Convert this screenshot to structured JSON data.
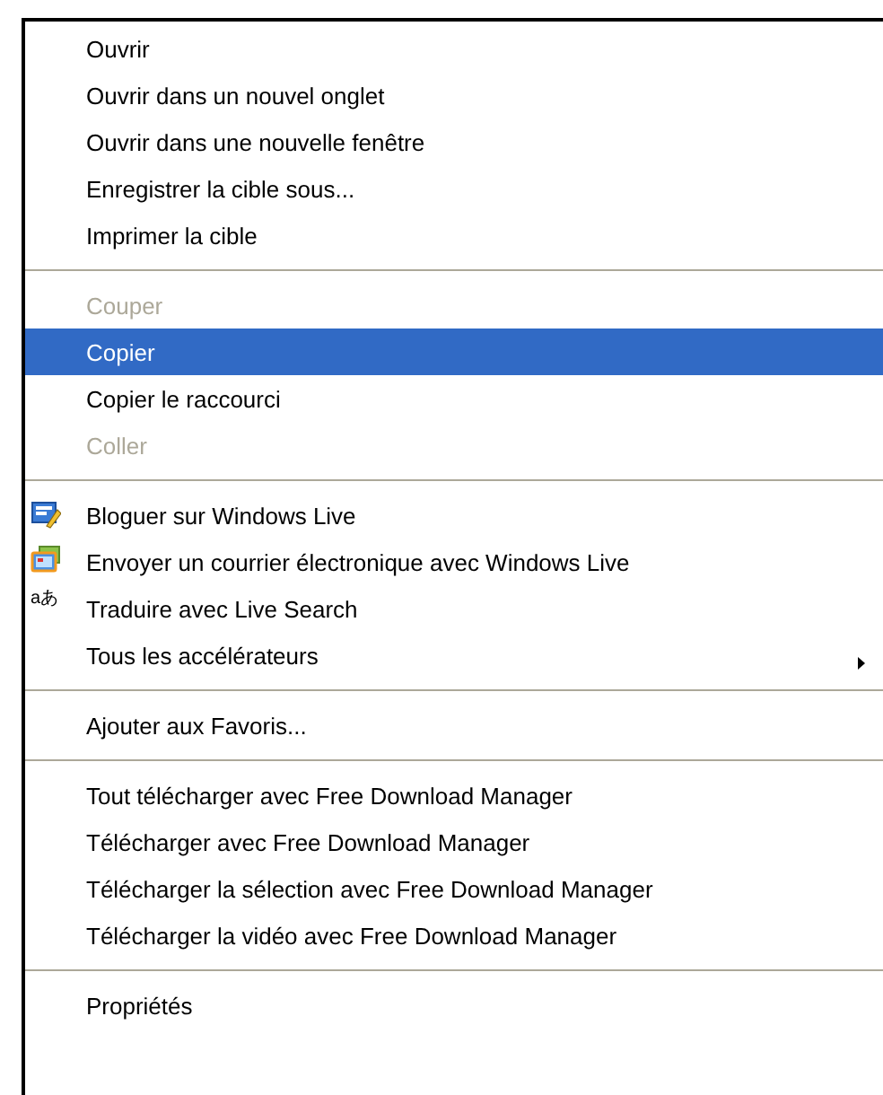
{
  "context_menu": {
    "items": [
      {
        "kind": "command",
        "label": "Ouvrir",
        "disabled": false,
        "selected": false
      },
      {
        "kind": "command",
        "label": "Ouvrir dans un nouvel onglet",
        "disabled": false,
        "selected": false
      },
      {
        "kind": "command",
        "label": "Ouvrir dans une nouvelle fenêtre",
        "disabled": false,
        "selected": false
      },
      {
        "kind": "command",
        "label": "Enregistrer la cible sous...",
        "disabled": false,
        "selected": false
      },
      {
        "kind": "command",
        "label": "Imprimer la cible",
        "disabled": false,
        "selected": false
      },
      {
        "kind": "separator"
      },
      {
        "kind": "command",
        "label": "Couper",
        "disabled": true,
        "selected": false
      },
      {
        "kind": "command",
        "label": "Copier",
        "disabled": false,
        "selected": true
      },
      {
        "kind": "command",
        "label": "Copier le raccourci",
        "disabled": false,
        "selected": false
      },
      {
        "kind": "command",
        "label": "Coller",
        "disabled": true,
        "selected": false
      },
      {
        "kind": "separator"
      },
      {
        "kind": "blog",
        "label": "Bloguer sur Windows Live",
        "disabled": false,
        "selected": false
      },
      {
        "kind": "mail",
        "label": "Envoyer un courrier électronique avec Windows Live",
        "disabled": false,
        "selected": false
      },
      {
        "kind": "translate",
        "icon_text": "aあ",
        "label": "Traduire avec Live Search",
        "disabled": false,
        "selected": false
      },
      {
        "kind": "submenu",
        "label": "Tous les accélérateurs",
        "disabled": false,
        "selected": false
      },
      {
        "kind": "separator"
      },
      {
        "kind": "command",
        "label": "Ajouter aux Favoris...",
        "disabled": false,
        "selected": false
      },
      {
        "kind": "separator"
      },
      {
        "kind": "command",
        "label": "Tout télécharger avec Free Download Manager",
        "disabled": false,
        "selected": false
      },
      {
        "kind": "command",
        "label": "Télécharger avec Free Download Manager",
        "disabled": false,
        "selected": false
      },
      {
        "kind": "command",
        "label": "Télécharger la sélection avec Free Download Manager",
        "disabled": false,
        "selected": false
      },
      {
        "kind": "command",
        "label": "Télécharger la vidéo avec Free Download Manager",
        "disabled": false,
        "selected": false
      },
      {
        "kind": "separator"
      },
      {
        "kind": "command",
        "label": "Propriétés",
        "disabled": false,
        "selected": false
      }
    ]
  }
}
